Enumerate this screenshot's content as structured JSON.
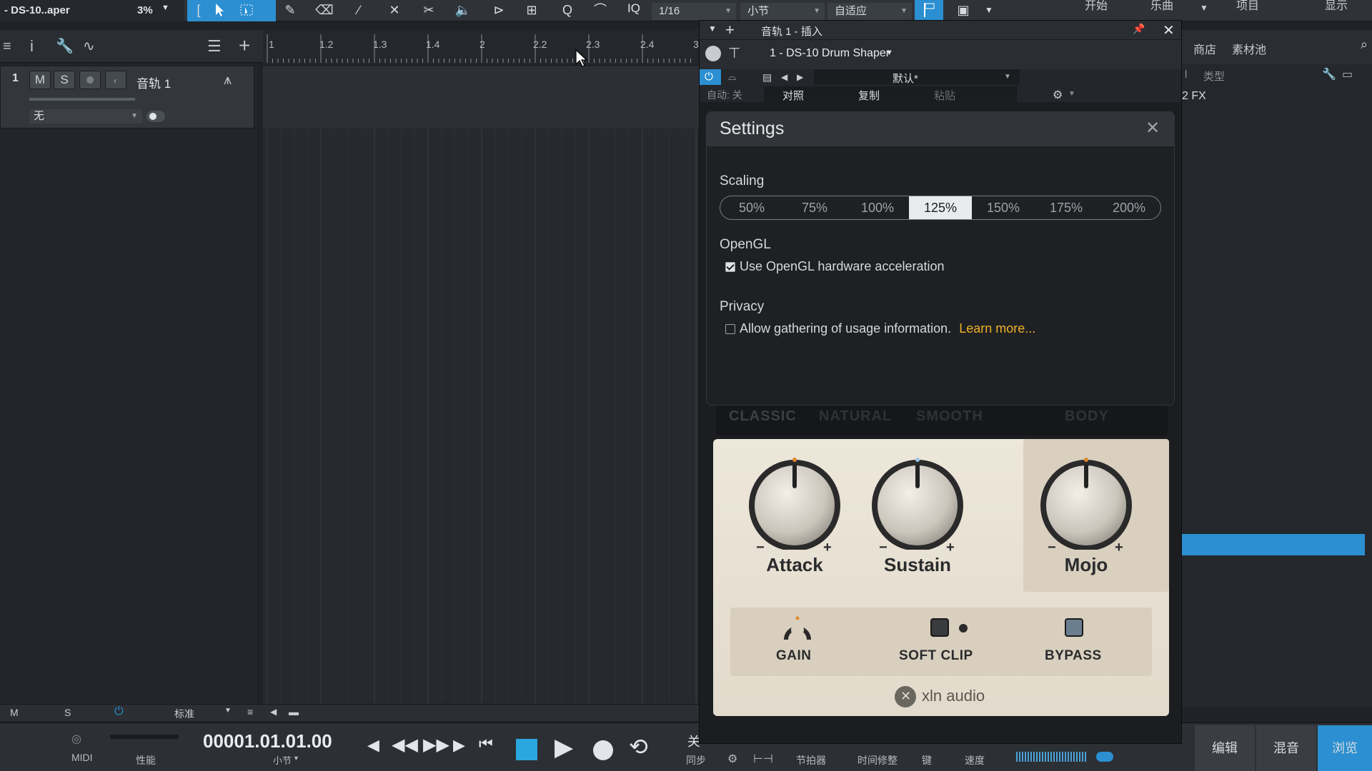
{
  "toolbar": {
    "song_title": "- DS-10..aper",
    "cpu_percent": "3%",
    "iq_label": "IQ",
    "quantize": "1/16",
    "timebase": "小节",
    "snap": "自适应",
    "menu_start": "开始",
    "menu_song": "乐曲",
    "menu_project": "项目",
    "menu_display": "显示"
  },
  "ruler": {
    "marks": [
      "1",
      "1.2",
      "1.3",
      "1.4",
      "2",
      "2.2",
      "2.3",
      "2.4",
      "3"
    ]
  },
  "track": {
    "number": "1",
    "mute": "M",
    "solo": "S",
    "name": "音轨 1",
    "input": "无"
  },
  "browser": {
    "tab_store": "商店",
    "tab_pool": "素材池",
    "col_type": "类型",
    "item_fx": "2 FX"
  },
  "plugin_window": {
    "title": "音轨 1 - 插入",
    "plugin_name": "1 - DS-10 Drum Shaper",
    "auto_label": "自动: 关",
    "preset": "默认*",
    "compare": "对照",
    "copy": "复制",
    "paste": "粘贴"
  },
  "settings": {
    "title": "Settings",
    "scaling_label": "Scaling",
    "scaling_options": [
      "50%",
      "75%",
      "100%",
      "125%",
      "150%",
      "175%",
      "200%"
    ],
    "scaling_selected": "125%",
    "opengl_label": "OpenGL",
    "opengl_option": "Use OpenGL hardware acceleration",
    "opengl_checked": true,
    "privacy_label": "Privacy",
    "privacy_option": "Allow gathering of usage information.",
    "privacy_checked": false,
    "learn_more": "Learn more..."
  },
  "drum_shaper": {
    "modes": [
      "CLASSIC",
      "NATURAL",
      "SMOOTH",
      "BODY"
    ],
    "knob_attack": "Attack",
    "knob_sustain": "Sustain",
    "knob_mojo": "Mojo",
    "gain": "GAIN",
    "soft_clip": "SOFT CLIP",
    "bypass": "BYPASS",
    "brand": "xln audio",
    "minus": "−",
    "plus": "+"
  },
  "bottom": {
    "m": "M",
    "s": "S",
    "standard": "标准",
    "midi": "MIDI",
    "performance": "性能",
    "position": "00001.01.01.00",
    "position_unit": "小节",
    "off": "关",
    "sync": "同步",
    "metronome": "节拍器",
    "time_correct": "时间修整",
    "key": "键",
    "speed": "速度",
    "tab_edit": "编辑",
    "tab_mix": "混音",
    "tab_browse": "浏览"
  },
  "colors": {
    "accent_blue": "#2b8fd1",
    "learn_more_orange": "#f0b127",
    "panel_cream": "#ede7da"
  }
}
